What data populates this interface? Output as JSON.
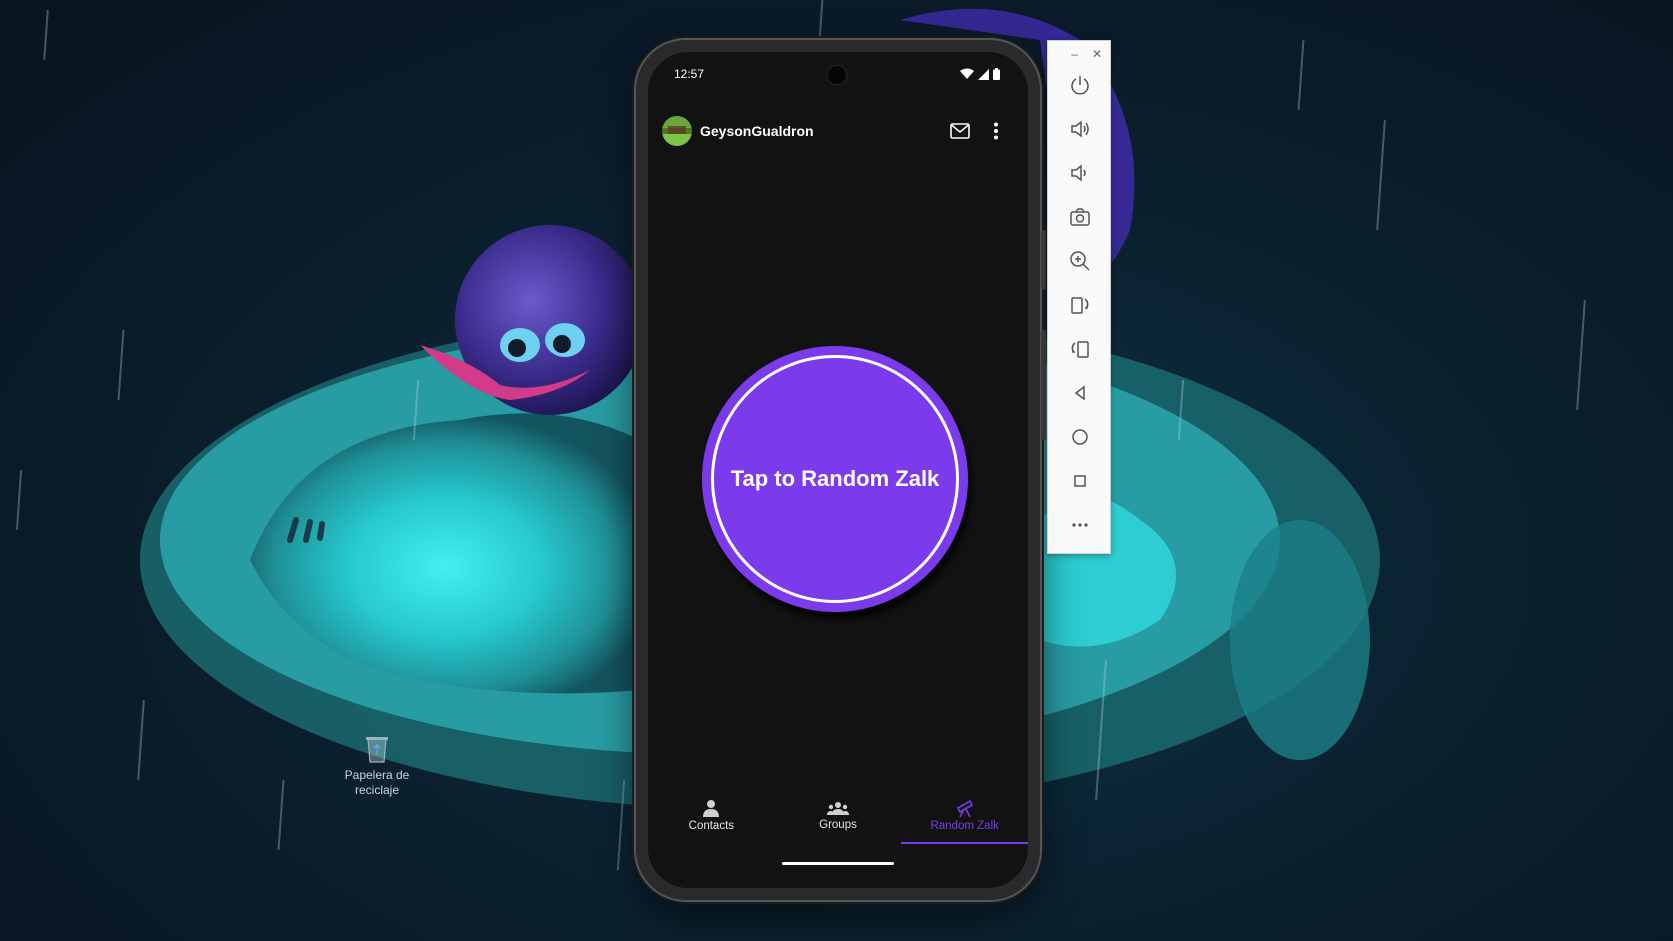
{
  "desktop": {
    "recycle_bin_label": "Papelera de reciclaje"
  },
  "phone": {
    "status_bar": {
      "time": "12:57",
      "icons": [
        "wifi-icon",
        "cellular-signal-icon",
        "battery-icon"
      ]
    },
    "app_bar": {
      "username": "GeysonGualdron",
      "avatar": "avatar",
      "actions": [
        "mail-icon",
        "more-vert-icon"
      ]
    },
    "main": {
      "button_label": "Tap to Random Zalk"
    },
    "bottom_nav": {
      "items": [
        {
          "label": "Contacts",
          "icon": "person-icon",
          "active": false
        },
        {
          "label": "Groups",
          "icon": "groups-icon",
          "active": false
        },
        {
          "label": "Random Zalk",
          "icon": "telescope-icon",
          "active": true
        }
      ]
    }
  },
  "emulator_toolbar": {
    "window_controls": [
      "minimize",
      "close"
    ],
    "tools": [
      "power",
      "volume-up",
      "volume-down",
      "screenshot",
      "zoom",
      "rotate-left",
      "rotate-right",
      "back",
      "home",
      "overview",
      "more"
    ]
  },
  "colors": {
    "accent": "#7c3aed",
    "screen_background": "#121212",
    "toolbar_background": "#fafafa"
  }
}
